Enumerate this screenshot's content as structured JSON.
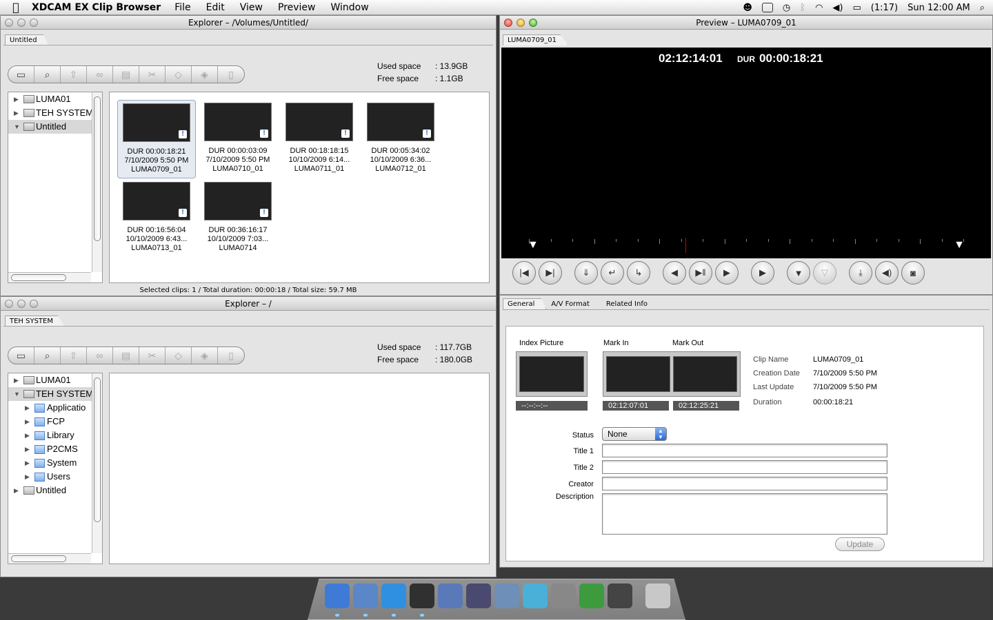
{
  "menubar": {
    "app_name": "XDCAM EX Clip Browser",
    "items": [
      "File",
      "Edit",
      "View",
      "Preview",
      "Window"
    ],
    "battery": "(1:17)",
    "clock": "Sun 12:00 AM",
    "icons": [
      "apple-icon",
      "tweety-icon",
      "display-icon",
      "time-machine-icon",
      "bluetooth-icon",
      "wifi-icon",
      "volume-icon",
      "battery-icon",
      "spotlight-icon"
    ]
  },
  "explorer_top": {
    "title": "Explorer – /Volumes/Untitled/",
    "tab": "Untitled",
    "used_space_label": "Used space",
    "used_space_value": ": 13.9GB",
    "free_space_label": "Free space",
    "free_space_value": ": 1.1GB",
    "tree": [
      {
        "label": "LUMA01",
        "expanded": false
      },
      {
        "label": "TEH SYSTEM",
        "expanded": false
      },
      {
        "label": "Untitled",
        "expanded": true,
        "selected": true
      }
    ],
    "clips": [
      {
        "dur": "DUR 00:00:18:21",
        "date": "7/10/2009 5:50 PM",
        "name": "LUMA0709_01",
        "selected": true
      },
      {
        "dur": "DUR 00:00:03:09",
        "date": "7/10/2009 5:50 PM",
        "name": "LUMA0710_01"
      },
      {
        "dur": "DUR 00:18:18:15",
        "date": "10/10/2009 6:14...",
        "name": "LUMA0711_01"
      },
      {
        "dur": "DUR 00:05:34:02",
        "date": "10/10/2009 6:36...",
        "name": "LUMA0712_01"
      },
      {
        "dur": "DUR 00:16:56:04",
        "date": "10/10/2009 6:43...",
        "name": "LUMA0713_01"
      },
      {
        "dur": "DUR 00:36:16:17",
        "date": "10/10/2009 7:03...",
        "name": "LUMA0714"
      }
    ],
    "status": "Selected clips: 1 / Total duration: 00:00:18 / Total size: 59.7 MB"
  },
  "explorer_bottom": {
    "title": "Explorer – /",
    "tab": "TEH SYSTEM",
    "used_space_label": "Used space",
    "used_space_value": ": 117.7GB",
    "free_space_label": "Free space",
    "free_space_value": ": 180.0GB",
    "tree": [
      {
        "label": "LUMA01",
        "level": 0
      },
      {
        "label": "TEH SYSTEM",
        "level": 0,
        "expanded": true,
        "selected": true
      },
      {
        "label": "Applicatio",
        "level": 1
      },
      {
        "label": "FCP",
        "level": 1
      },
      {
        "label": "Library",
        "level": 1
      },
      {
        "label": "P2CMS",
        "level": 1
      },
      {
        "label": "System",
        "level": 1
      },
      {
        "label": "Users",
        "level": 1
      },
      {
        "label": "Untitled",
        "level": 0
      }
    ]
  },
  "toolbar": {
    "buttons": [
      {
        "icon": "open-folder-icon",
        "enabled": true
      },
      {
        "icon": "search-icon",
        "enabled": true
      },
      {
        "icon": "up-arrow-icon",
        "enabled": false
      },
      {
        "icon": "link-icon",
        "enabled": false
      },
      {
        "icon": "select-all-icon",
        "enabled": false
      },
      {
        "icon": "scissors-icon",
        "enabled": false
      },
      {
        "icon": "tag-icon",
        "enabled": false
      },
      {
        "icon": "eraser-icon",
        "enabled": false
      },
      {
        "icon": "trash-icon",
        "enabled": false
      }
    ]
  },
  "preview": {
    "title": "Preview – LUMA0709_01",
    "tab": "LUMA0709_01",
    "timecode": "02:12:14:01",
    "dur_label": "DUR",
    "dur_value": "00:00:18:21",
    "playhead_fraction": 0.36
  },
  "transport": {
    "buttons": [
      {
        "icon": "go-to-start-icon",
        "enabled": true,
        "glyph": "|◀"
      },
      {
        "icon": "go-to-end-icon",
        "enabled": true,
        "glyph": "▶|"
      },
      {
        "icon": "prev-clip-icon",
        "enabled": true,
        "glyph": "⇓"
      },
      {
        "icon": "prev-essence-mark-icon",
        "enabled": true,
        "glyph": "↵"
      },
      {
        "icon": "next-essence-mark-icon",
        "enabled": true,
        "glyph": "↳"
      },
      {
        "icon": "step-back-icon",
        "enabled": true,
        "glyph": "◀"
      },
      {
        "icon": "play-pause-icon",
        "enabled": true,
        "glyph": "▶‖"
      },
      {
        "icon": "step-forward-icon",
        "enabled": true,
        "glyph": "▶"
      },
      {
        "icon": "play-icon",
        "enabled": true,
        "glyph": "▶"
      },
      {
        "icon": "mark-in-icon",
        "enabled": true,
        "glyph": "▼"
      },
      {
        "icon": "mark-out-icon",
        "enabled": false,
        "glyph": "▽"
      },
      {
        "icon": "import-icon",
        "enabled": true,
        "glyph": "⤓"
      },
      {
        "icon": "audio-icon",
        "enabled": true,
        "glyph": "◀)"
      },
      {
        "icon": "camera-icon",
        "enabled": true,
        "glyph": "◙"
      }
    ]
  },
  "info": {
    "tabs": [
      "General",
      "A/V Format",
      "Related Info"
    ],
    "index_picture_label": "Index Picture",
    "index_picture_tc": "--:--:--:--",
    "mark_in_label": "Mark In",
    "mark_in_tc": "02:12:07:01",
    "mark_out_label": "Mark Out",
    "mark_out_tc": "02:12:25:21",
    "clip_name_label": "Clip Name",
    "clip_name": "LUMA0709_01",
    "creation_date_label": "Creation Date",
    "creation_date": "7/10/2009 5:50 PM",
    "last_update_label": "Last Update",
    "last_update": "7/10/2009 5:50 PM",
    "duration_label": "Duration",
    "duration": "00:00:18:21",
    "status_label": "Status",
    "status_value": "None",
    "title1_label": "Title 1",
    "title1_value": "",
    "title2_label": "Title 2",
    "title2_value": "",
    "creator_label": "Creator",
    "creator_value": "",
    "description_label": "Description",
    "description_value": "",
    "update_button": "Update"
  },
  "dock": {
    "items": [
      "finder-icon",
      "mail-bird-icon",
      "safari-icon",
      "final-cut-icon",
      "preview-icon",
      "imovie-icon",
      "iphoto-icon",
      "itunes-icon",
      "system-preferences-icon",
      "adium-icon",
      "camcorder-icon",
      "trash-icon"
    ],
    "colors": [
      "#3f7bd6",
      "#5b86c7",
      "#2f8fe0",
      "#303030",
      "#5a79b8",
      "#4a4a70",
      "#6d8fb8",
      "#4ab0d8",
      "#888888",
      "#3d9a3d",
      "#444444",
      "#c8c8c8"
    ]
  }
}
